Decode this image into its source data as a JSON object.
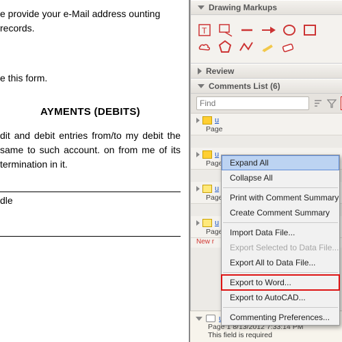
{
  "doc": {
    "p1": "e provide your e-Mail address ounting records.",
    "p2": "e this form.",
    "heading": "AYMENTS (DEBITS)",
    "p3": "dit and debit entries from/to my debit the same to such account. on from me of its termination in it.",
    "sig1": "dle"
  },
  "panels": {
    "drawing": "Drawing Markups",
    "review": "Review",
    "comments": "Comments List (6)"
  },
  "search": {
    "placeholder": "Find"
  },
  "menu": {
    "expand": "Expand All",
    "collapse": "Collapse All",
    "printSummary": "Print with Comment Summary",
    "createSummary": "Create Comment Summary",
    "importData": "Import Data File...",
    "exportSel": "Export Selected to Data File...",
    "exportAll": "Export All to Data File...",
    "exportWord": "Export to Word...",
    "exportCAD": "Export to AutoCAD...",
    "prefs": "Commenting Preferences..."
  },
  "comments": [
    {
      "user": "u",
      "page": "Page"
    },
    {
      "user": "u",
      "page": "Page"
    },
    {
      "user": "u",
      "page": "Page"
    },
    {
      "user": "u",
      "page": "Page"
    }
  ],
  "newLabel": "New r",
  "popup": {
    "user": "user",
    "meta": "Page 1  8/13/2012 7:33:14 PM",
    "body": "This field is required"
  }
}
